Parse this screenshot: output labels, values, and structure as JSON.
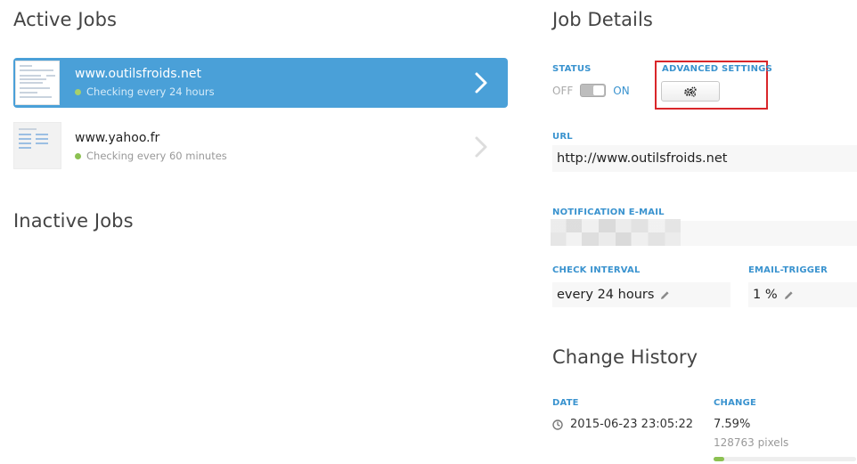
{
  "left": {
    "active_title": "Active Jobs",
    "inactive_title": "Inactive Jobs",
    "active_jobs": [
      {
        "name": "www.outilsfroids.net",
        "status": "Checking every 24 hours",
        "selected": true
      },
      {
        "name": "www.yahoo.fr",
        "status": "Checking every 60 minutes",
        "selected": false
      }
    ]
  },
  "details": {
    "title": "Job Details",
    "status_label": "STATUS",
    "status_off": "OFF",
    "status_on": "ON",
    "advanced_label": "ADVANCED SETTINGS",
    "advanced_icon": "gears-icon",
    "url_label": "URL",
    "url_value": "http://www.outilsfroids.net",
    "email_label": "NOTIFICATION E-MAIL",
    "interval_label": "CHECK INTERVAL",
    "interval_value": "every 24 hours",
    "trigger_label": "EMAIL-TRIGGER",
    "trigger_value": "1 %"
  },
  "history": {
    "title": "Change History",
    "date_label": "DATE",
    "change_label": "CHANGE",
    "rows": [
      {
        "date": "2015-06-23 23:05:22",
        "change": "7.59%",
        "pixels": "128763 pixels",
        "fraction": 0.0759
      }
    ]
  },
  "colors": {
    "accent": "#4aa0d8",
    "label": "#3a93cf",
    "ok": "#8cc152",
    "highlight": "#d9262a"
  }
}
